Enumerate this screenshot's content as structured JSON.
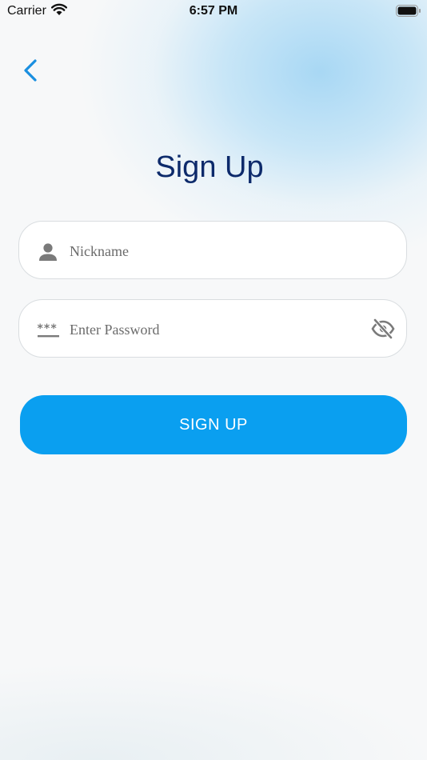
{
  "status_bar": {
    "carrier": "Carrier",
    "time": "6:57 PM"
  },
  "nav": {
    "back_icon": "chevron-left-icon"
  },
  "page": {
    "title": "Sign Up"
  },
  "form": {
    "nickname": {
      "placeholder": "Nickname",
      "value": "",
      "icon": "person-icon"
    },
    "password": {
      "placeholder": "Enter Password",
      "value": "",
      "icon": "password-dots-icon",
      "toggle_icon": "eye-off-icon"
    },
    "submit_label": "SIGN UP"
  },
  "colors": {
    "accent": "#0a9ff0",
    "title": "#0d2a6b",
    "back_arrow": "#1a8fe0",
    "icon_gray": "#7a7a7a"
  }
}
